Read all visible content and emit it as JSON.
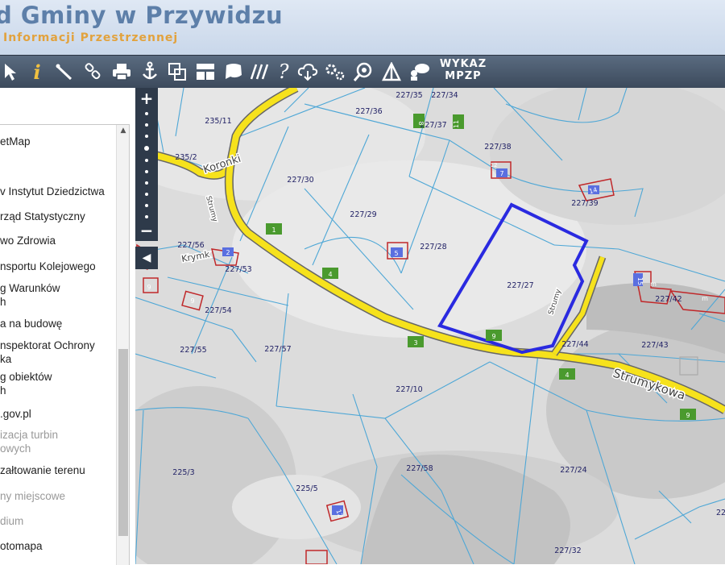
{
  "header": {
    "title": "d Gminy w Przywidzu",
    "subtitle": "Informacji Przestrzennej"
  },
  "toolbar": {
    "tools": [
      "pointer-icon",
      "info-icon",
      "measure-icon",
      "link-icon",
      "print-icon",
      "anchor-icon",
      "copy-icon",
      "layout-icon",
      "bubble-icon",
      "hatch-icon",
      "help-icon",
      "cloud-icon",
      "settings-icon",
      "search-map-icon",
      "triangle-icon",
      "chat-icon"
    ],
    "help_glyph": "?",
    "info_glyph": "i",
    "wykaz_line1": "WYKAZ",
    "wykaz_line2": "MPZP"
  },
  "sidebar": {
    "layers": [
      {
        "label": "etMap",
        "muted": false
      },
      {
        "label": "v Instytut Dziedzictwa",
        "muted": false
      },
      {
        "label": "rząd Statystyczny",
        "muted": false
      },
      {
        "label": "wo Zdrowia",
        "muted": false
      },
      {
        "label": "nsportu Kolejowego",
        "muted": false
      },
      {
        "label": "g Warunków\nh",
        "muted": false
      },
      {
        "label": "a na budowę",
        "muted": false
      },
      {
        "label": "nspektorat Ochrony\nka",
        "muted": false
      },
      {
        "label": "g obiektów\nh",
        "muted": false
      },
      {
        "label": ".gov.pl",
        "muted": false
      },
      {
        "label": "izacja turbin\nowych",
        "muted": true
      },
      {
        "label": "załtowanie terenu",
        "muted": false
      },
      {
        "label": "ny miejscowe",
        "muted": true
      },
      {
        "label": "dium",
        "muted": true
      },
      {
        "label": "otomapa",
        "muted": false
      }
    ]
  },
  "map": {
    "zoom_in": "+",
    "zoom_out": "−",
    "collapse": "◀",
    "streets": [
      "Koronki",
      "Strumykowa",
      "Krymk",
      "Strumy",
      "Strumy"
    ],
    "parcels": [
      "227/35",
      "227/34",
      "227/36",
      "227/37",
      "235/11",
      "235/2",
      "227/38",
      "227/30",
      "227/39",
      "227/29",
      "227/28",
      "227/56",
      "227/53",
      "227/27",
      "227/42",
      "227/54",
      "227/55",
      "227/57",
      "227/44",
      "227/43",
      "227/10",
      "227/58",
      "227/24",
      "225/3",
      "225/5",
      "227/32",
      "22"
    ],
    "building_numbers": [
      "7",
      "14",
      "5",
      "2",
      "9",
      "9",
      "15",
      "12",
      "m",
      "m"
    ],
    "marker_numbers": [
      "1",
      "4",
      "3",
      "9",
      "4",
      "9",
      "8",
      "11",
      "12"
    ]
  }
}
